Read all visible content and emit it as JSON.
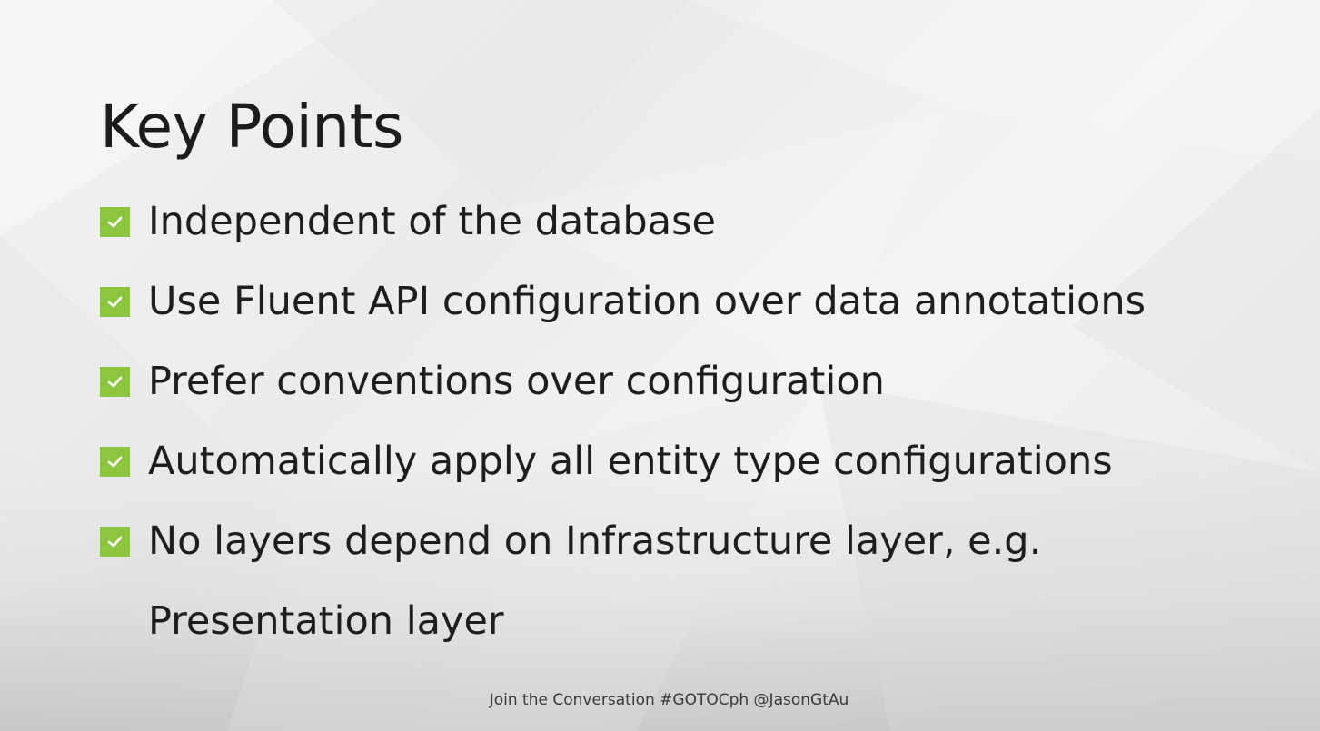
{
  "slide": {
    "title": "Key Points",
    "points": [
      "Independent of the database",
      "Use Fluent API configuration over data annotations",
      "Prefer conventions over configuration",
      "Automatically apply all entity type configurations",
      "No layers depend on Infrastructure layer, e.g. Presentation layer"
    ],
    "bullet_icon": "green-checkbox-icon",
    "bullet_color": "#8cc641",
    "footer": "Join the Conversation #GOTOCph @JasonGtAu"
  }
}
